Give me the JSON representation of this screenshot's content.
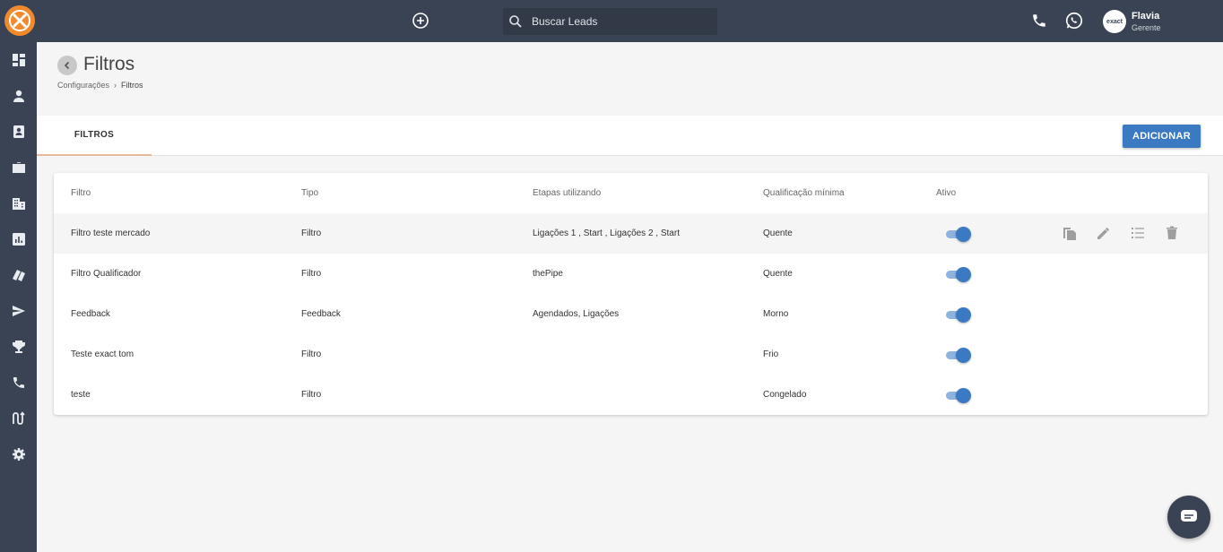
{
  "topbar": {
    "search_placeholder": "Buscar Leads",
    "user_name": "Flavia",
    "user_role": "Gerente",
    "avatar_text": "exact"
  },
  "sidebar": {
    "items": [
      {
        "icon": "dashboard-icon"
      },
      {
        "icon": "person-icon"
      },
      {
        "icon": "contact-card-icon"
      },
      {
        "icon": "briefcase-icon"
      },
      {
        "icon": "building-icon"
      },
      {
        "icon": "bar-chart-icon"
      },
      {
        "icon": "tags-icon"
      },
      {
        "icon": "send-icon"
      },
      {
        "icon": "trophy-icon"
      },
      {
        "icon": "phone-icon"
      },
      {
        "icon": "route-icon"
      },
      {
        "icon": "gear-icon"
      }
    ]
  },
  "header": {
    "title": "Filtros",
    "breadcrumb": [
      "Configurações",
      "Filtros"
    ]
  },
  "tabs": [
    {
      "label": "FILTROS",
      "active": true
    }
  ],
  "actions": {
    "add_label": "ADICIONAR"
  },
  "table": {
    "headers": [
      "Filtro",
      "Tipo",
      "Etapas utilizando",
      "Qualificação mínima",
      "Ativo"
    ],
    "rows": [
      {
        "filtro": "Filtro teste mercado",
        "tipo": "Filtro",
        "etapas": "Ligações 1 , Start , Ligações 2 , Start",
        "qualificacao": "Quente",
        "ativo": true
      },
      {
        "filtro": "Filtro Qualificador",
        "tipo": "Filtro",
        "etapas": "thePipe",
        "qualificacao": "Quente",
        "ativo": true
      },
      {
        "filtro": "Feedback",
        "tipo": "Feedback",
        "etapas": "Agendados, Ligações",
        "qualificacao": "Morno",
        "ativo": true
      },
      {
        "filtro": "Teste exact tom",
        "tipo": "Filtro",
        "etapas": "",
        "qualificacao": "Frio",
        "ativo": true
      },
      {
        "filtro": "teste",
        "tipo": "Filtro",
        "etapas": "",
        "qualificacao": "Congelado",
        "ativo": true
      }
    ]
  },
  "colors": {
    "topbar": "#3a4353",
    "accent": "#3b79c3",
    "logo": "#f08a2c"
  }
}
